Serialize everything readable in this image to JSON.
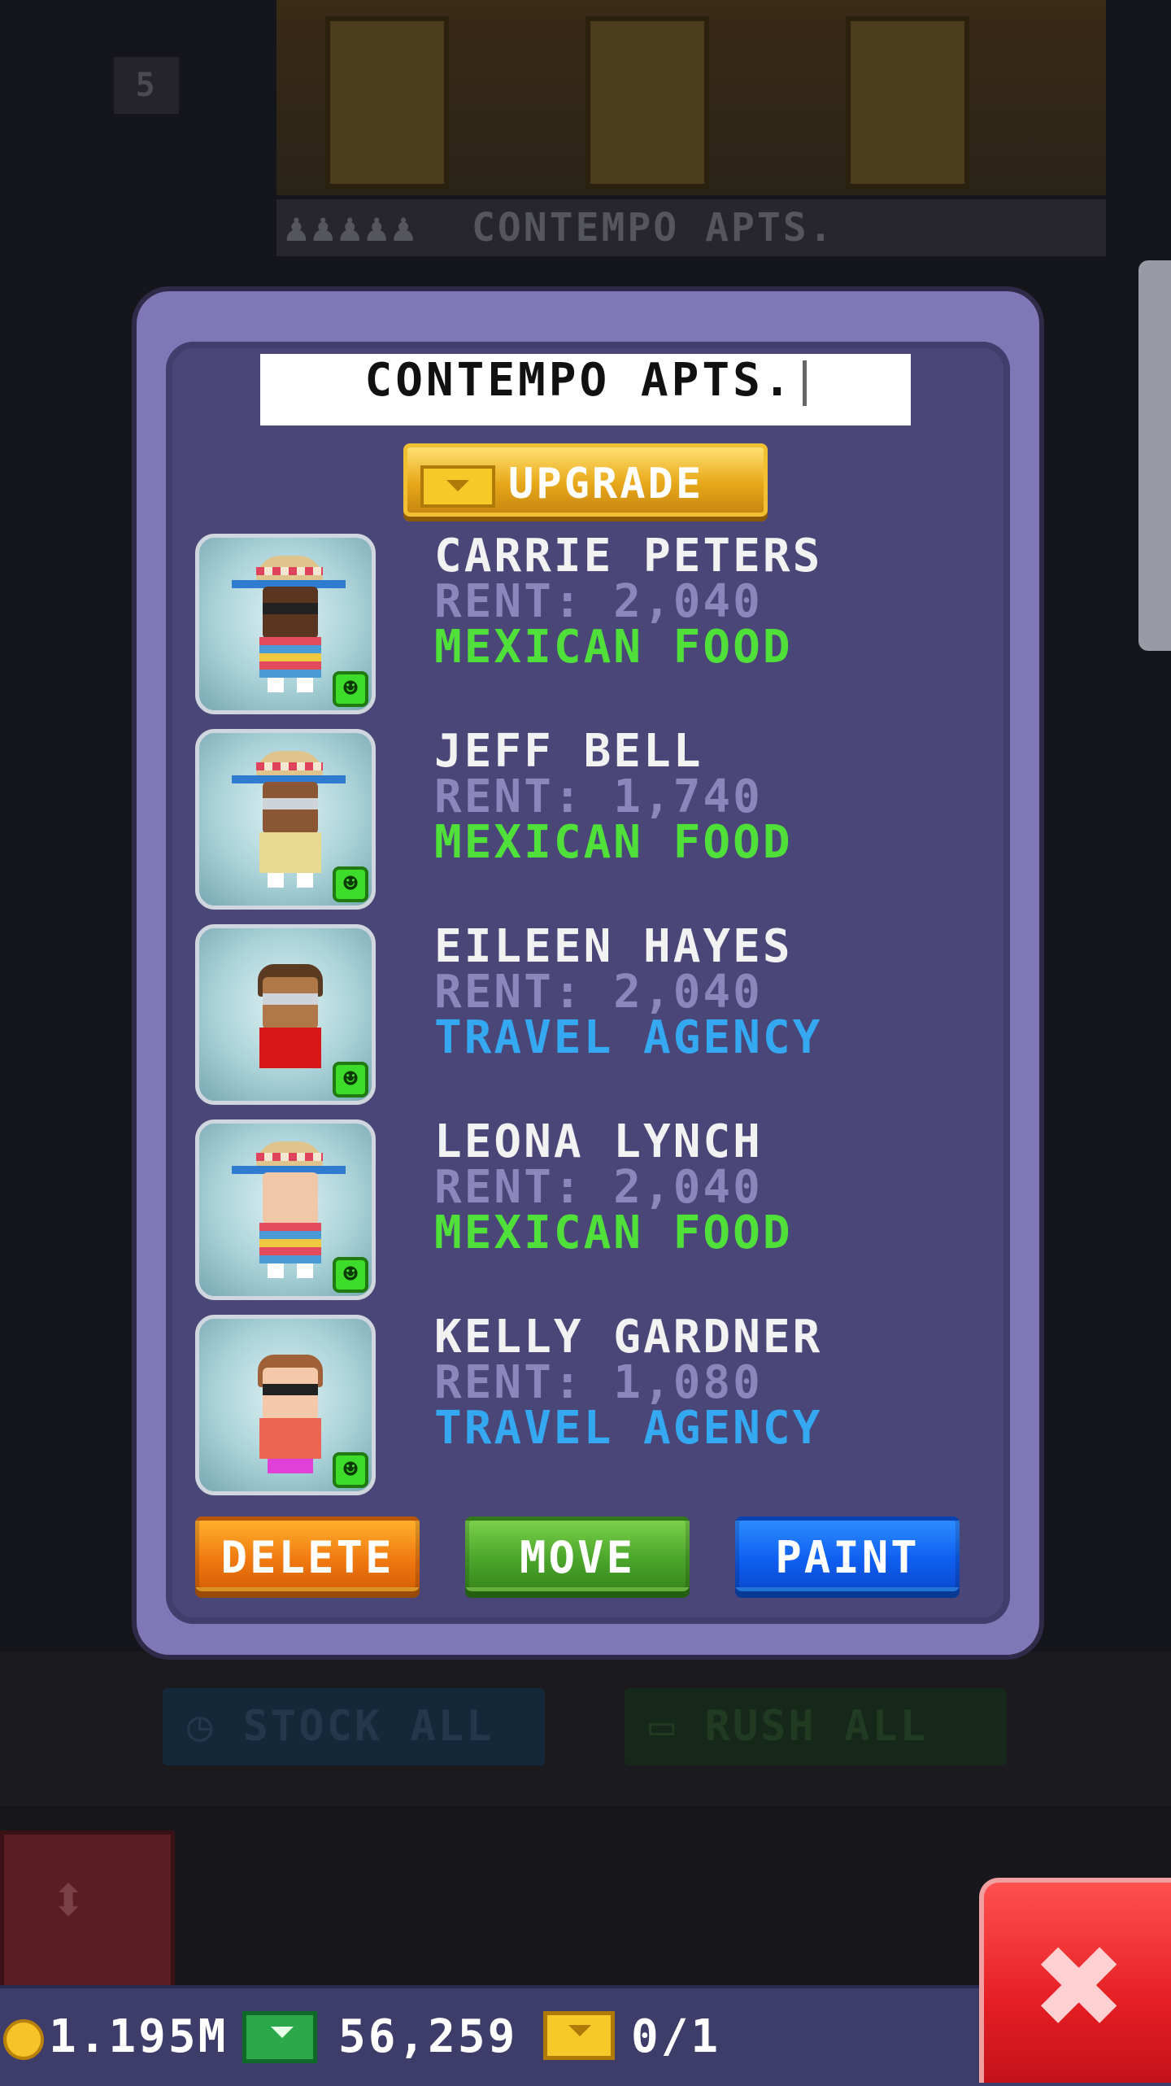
{
  "background": {
    "floor_number": "5",
    "floor_label_people": "♟♟♟♟♟",
    "floor_label_name": "CONTEMPO APTS.",
    "stock_all_label": "STOCK ALL",
    "rush_all_label": "RUSH ALL"
  },
  "dialog": {
    "floor_name_value": "CONTEMPO APTS.",
    "upgrade_label": "UPGRADE",
    "residents": [
      {
        "name": "CARRIE PETERS",
        "rent": "RENT: 2,040",
        "job": "MEXICAN FOOD",
        "job_color": "#4fe03a",
        "happy": true
      },
      {
        "name": "JEFF BELL",
        "rent": "RENT: 1,740",
        "job": "MEXICAN FOOD",
        "job_color": "#4fe03a",
        "happy": true
      },
      {
        "name": "EILEEN HAYES",
        "rent": "RENT: 2,040",
        "job": "TRAVEL AGENCY",
        "job_color": "#34a8f0",
        "happy": true
      },
      {
        "name": "LEONA LYNCH",
        "rent": "RENT: 2,040",
        "job": "MEXICAN FOOD",
        "job_color": "#4fe03a",
        "happy": true
      },
      {
        "name": "KELLY GARDNER",
        "rent": "RENT: 1,080",
        "job": "TRAVEL AGENCY",
        "job_color": "#34a8f0",
        "happy": true
      }
    ],
    "delete_label": "DELETE",
    "move_label": "MOVE",
    "paint_label": "PAINT"
  },
  "status_bar": {
    "coins": "1.195M",
    "cash": "56,259",
    "bux": "0/1"
  },
  "icons": {
    "close": "close-icon",
    "coin": "coin-icon",
    "cash": "cash-icon",
    "bux": "bux-icon",
    "happy": "smiley-icon"
  }
}
